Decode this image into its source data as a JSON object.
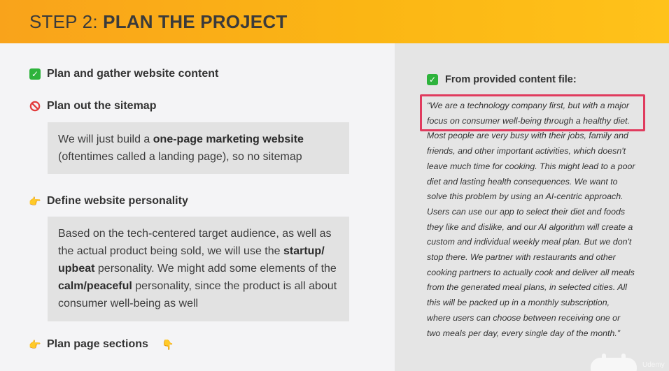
{
  "header": {
    "title_prefix": "STEP 2: ",
    "title_main": "PLAN THE PROJECT"
  },
  "left": {
    "items": [
      {
        "icon": "check-mark-icon",
        "label": "Plan and gather website content"
      },
      {
        "icon": "prohibited-icon",
        "label": "Plan out the sitemap"
      },
      {
        "icon": "hand-pointing-right-icon",
        "label": "Define website personality"
      },
      {
        "icon": "hand-pointing-right-icon",
        "label": "Plan page sections",
        "trailing_icon": "hand-pointing-down-icon"
      }
    ],
    "sitemap_box": {
      "line1_plain": "We will just build a ",
      "line1_bold": "one-page marketing website",
      "line2": "(oftentimes called a landing page), so no sitemap"
    },
    "personality_box": {
      "line1": "Based on the tech-centered target audience, as well as",
      "line2_plain": "the actual product being sold, we will use the ",
      "line2_bold": "startup/",
      "line3_bold": "upbeat",
      "line3_plain": " personality. We might add some elements of the",
      "line4_bold": "calm/peaceful",
      "line4_plain": " personality, since the product is all about",
      "line5": "consumer well-being as well"
    }
  },
  "right": {
    "source_label": "From provided content file:",
    "quote_lines": [
      "“We are a technology company first, but with a major",
      "focus on consumer well-being through a healthy diet.",
      "Most people are very busy with their jobs, family and",
      "friends, and other important activities, which doesn't",
      "leave much time for cooking. This might lead to a poor",
      "diet and lasting health consequences. We want to",
      "solve this problem by using an AI-centric approach.",
      "Users can use our app to select their diet and foods",
      "they like and dislike, and our AI algorithm will create a",
      "custom and individual weekly meal plan. But we don't",
      "stop there. We partner with restaurants and other",
      "cooking partners to actually cook and deliver all meals",
      "from the generated meal plans, in selected cities. All",
      "this will be packed up in a monthly subscription,",
      "where users can choose between receiving one or",
      "two meals per day, every single day of the month.”"
    ]
  },
  "watermark": "Udemy",
  "colors": {
    "header_start": "#f9a31b",
    "header_end": "#ffc21a",
    "highlight_border": "#e03b5e",
    "check_green": "#2eb33c"
  }
}
